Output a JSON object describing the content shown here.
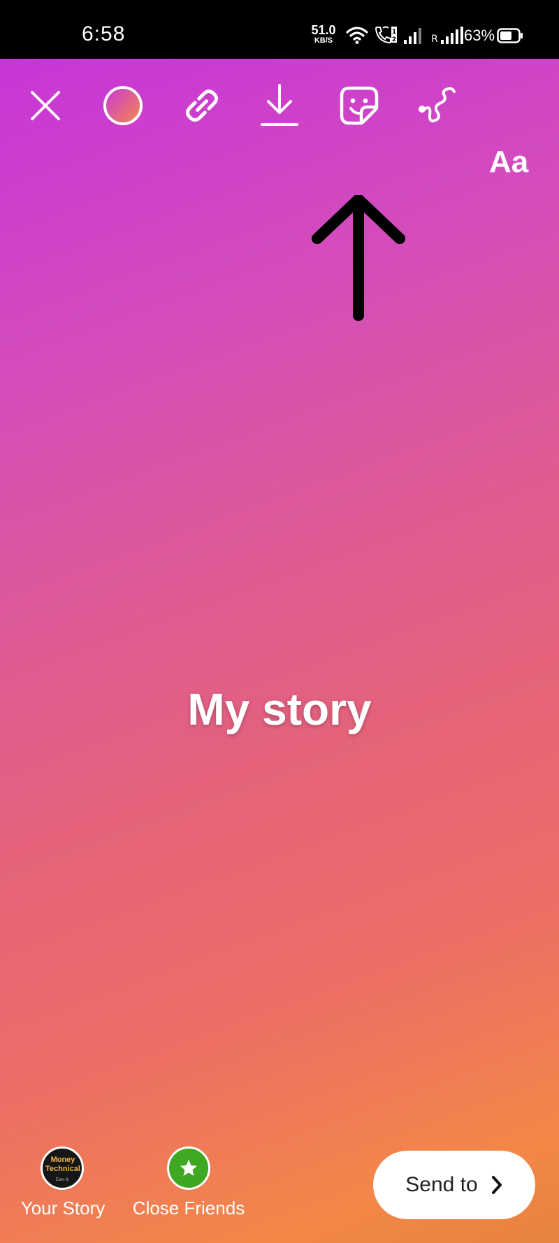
{
  "status_bar": {
    "time": "6:58",
    "net_speed_value": "51.0",
    "net_speed_unit": "KB/S",
    "battery_percent": "63%",
    "roaming_label": "R"
  },
  "toolbar": {
    "close_icon": "close-icon",
    "color_icon": "gradient-color-icon",
    "link_icon": "link-icon",
    "download_icon": "download-icon",
    "sticker_icon": "sticker-icon",
    "draw_icon": "draw-squiggle-icon",
    "text_tool_label": "Aa"
  },
  "story": {
    "text": "My story"
  },
  "bottom": {
    "your_story_label": "Your Story",
    "avatar_text": "Money Technical",
    "avatar_small_text": "Earn &",
    "close_friends_label": "Close Friends",
    "send_label": "Send to"
  }
}
